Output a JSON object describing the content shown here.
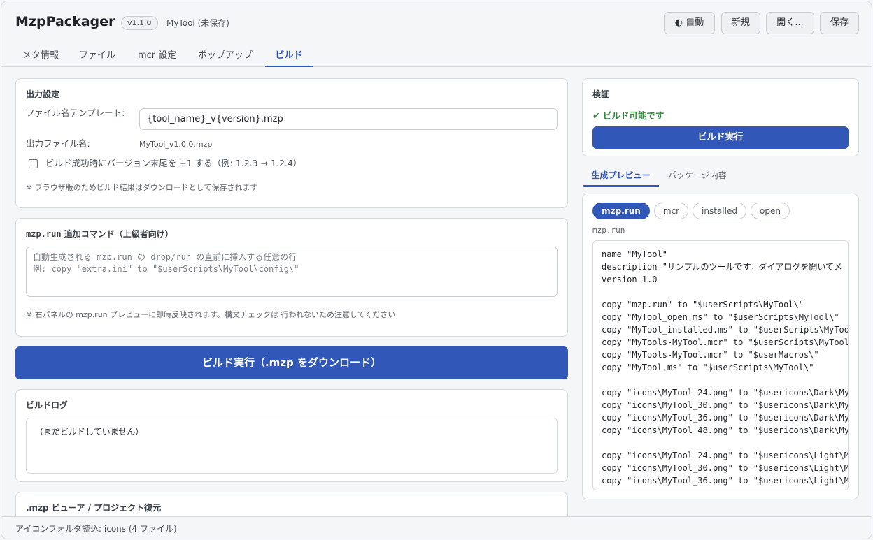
{
  "header": {
    "title": "MzpPackager",
    "version": "v1.1.0",
    "project": "MyTool (未保存)",
    "buttons": {
      "theme": "◐ 自動",
      "new": "新規",
      "open": "開く...",
      "save": "保存"
    }
  },
  "tabs": [
    "メタ情報",
    "ファイル",
    "mcr 設定",
    "ポップアップ",
    "ビルド"
  ],
  "active_tab": "ビルド",
  "output": {
    "title": "出力設定",
    "template_label": "ファイル名テンプレート:",
    "template_value": "{tool_name}_v{version}.mzp",
    "filename_label": "出力ファイル名:",
    "filename_value": "MyTool_v1.0.0.mzp",
    "bump_label": "ビルド成功時にバージョン末尾を +1 する（例: 1.2.3 → 1.2.4）",
    "note": "※ ブラウザ版のためビルド結果はダウンロードとして保存されます"
  },
  "extra": {
    "title_code": "mzp.run",
    "title_rest": " 追加コマンド（上級者向け）",
    "placeholder": "自動生成される mzp.run の drop/run の直前に挿入する任意の行\n例: copy \"extra.ini\" to \"$userScripts\\MyTool\\config\\\"",
    "note": "※ 右パネルの mzp.run プレビューに即時反映されます。構文チェックは 行われないため注意してください"
  },
  "build_button": "ビルド実行（.mzp をダウンロード）",
  "log": {
    "title": "ビルドログ",
    "content": "（まだビルドしていません）"
  },
  "viewer": {
    "title": ".mzp ビューア / プロジェクト復元"
  },
  "validation": {
    "title": "検証",
    "status": "✔ ビルド可能です",
    "button": "ビルド実行"
  },
  "preview_tabs": [
    "生成プレビュー",
    "パッケージ内容"
  ],
  "file_pills": [
    "mzp.run",
    "mcr",
    "installed",
    "open"
  ],
  "preview_file": "mzp.run",
  "preview_lines": [
    "name \"MyTool\"",
    "description \"サンプルのツールです。ダイアログを開いてメ",
    "version 1.0",
    "",
    "copy \"mzp.run\" to \"$userScripts\\MyTool\\\"",
    "copy \"MyTool_open.ms\" to \"$userScripts\\MyTool\\\"",
    "copy \"MyTool_installed.ms\" to \"$userScripts\\MyToo",
    "copy \"MyTools-MyTool.mcr\" to \"$userScripts\\MyTool",
    "copy \"MyTools-MyTool.mcr\" to \"$userMacros\\\"",
    "copy \"MyTool.ms\" to \"$userScripts\\MyTool\\\"",
    "",
    "copy \"icons\\MyTool_24.png\" to \"$usericons\\Dark\\My",
    "copy \"icons\\MyTool_30.png\" to \"$usericons\\Dark\\My",
    "copy \"icons\\MyTool_36.png\" to \"$usericons\\Dark\\My",
    "copy \"icons\\MyTool_48.png\" to \"$usericons\\Dark\\My",
    "",
    "copy \"icons\\MyTool_24.png\" to \"$usericons\\Light\\M",
    "copy \"icons\\MyTool_30.png\" to \"$usericons\\Light\\M",
    "copy \"icons\\MyTool_36.png\" to \"$usericons\\Light\\M"
  ],
  "status": "アイコンフォルダ読込: icons (4 ファイル)"
}
